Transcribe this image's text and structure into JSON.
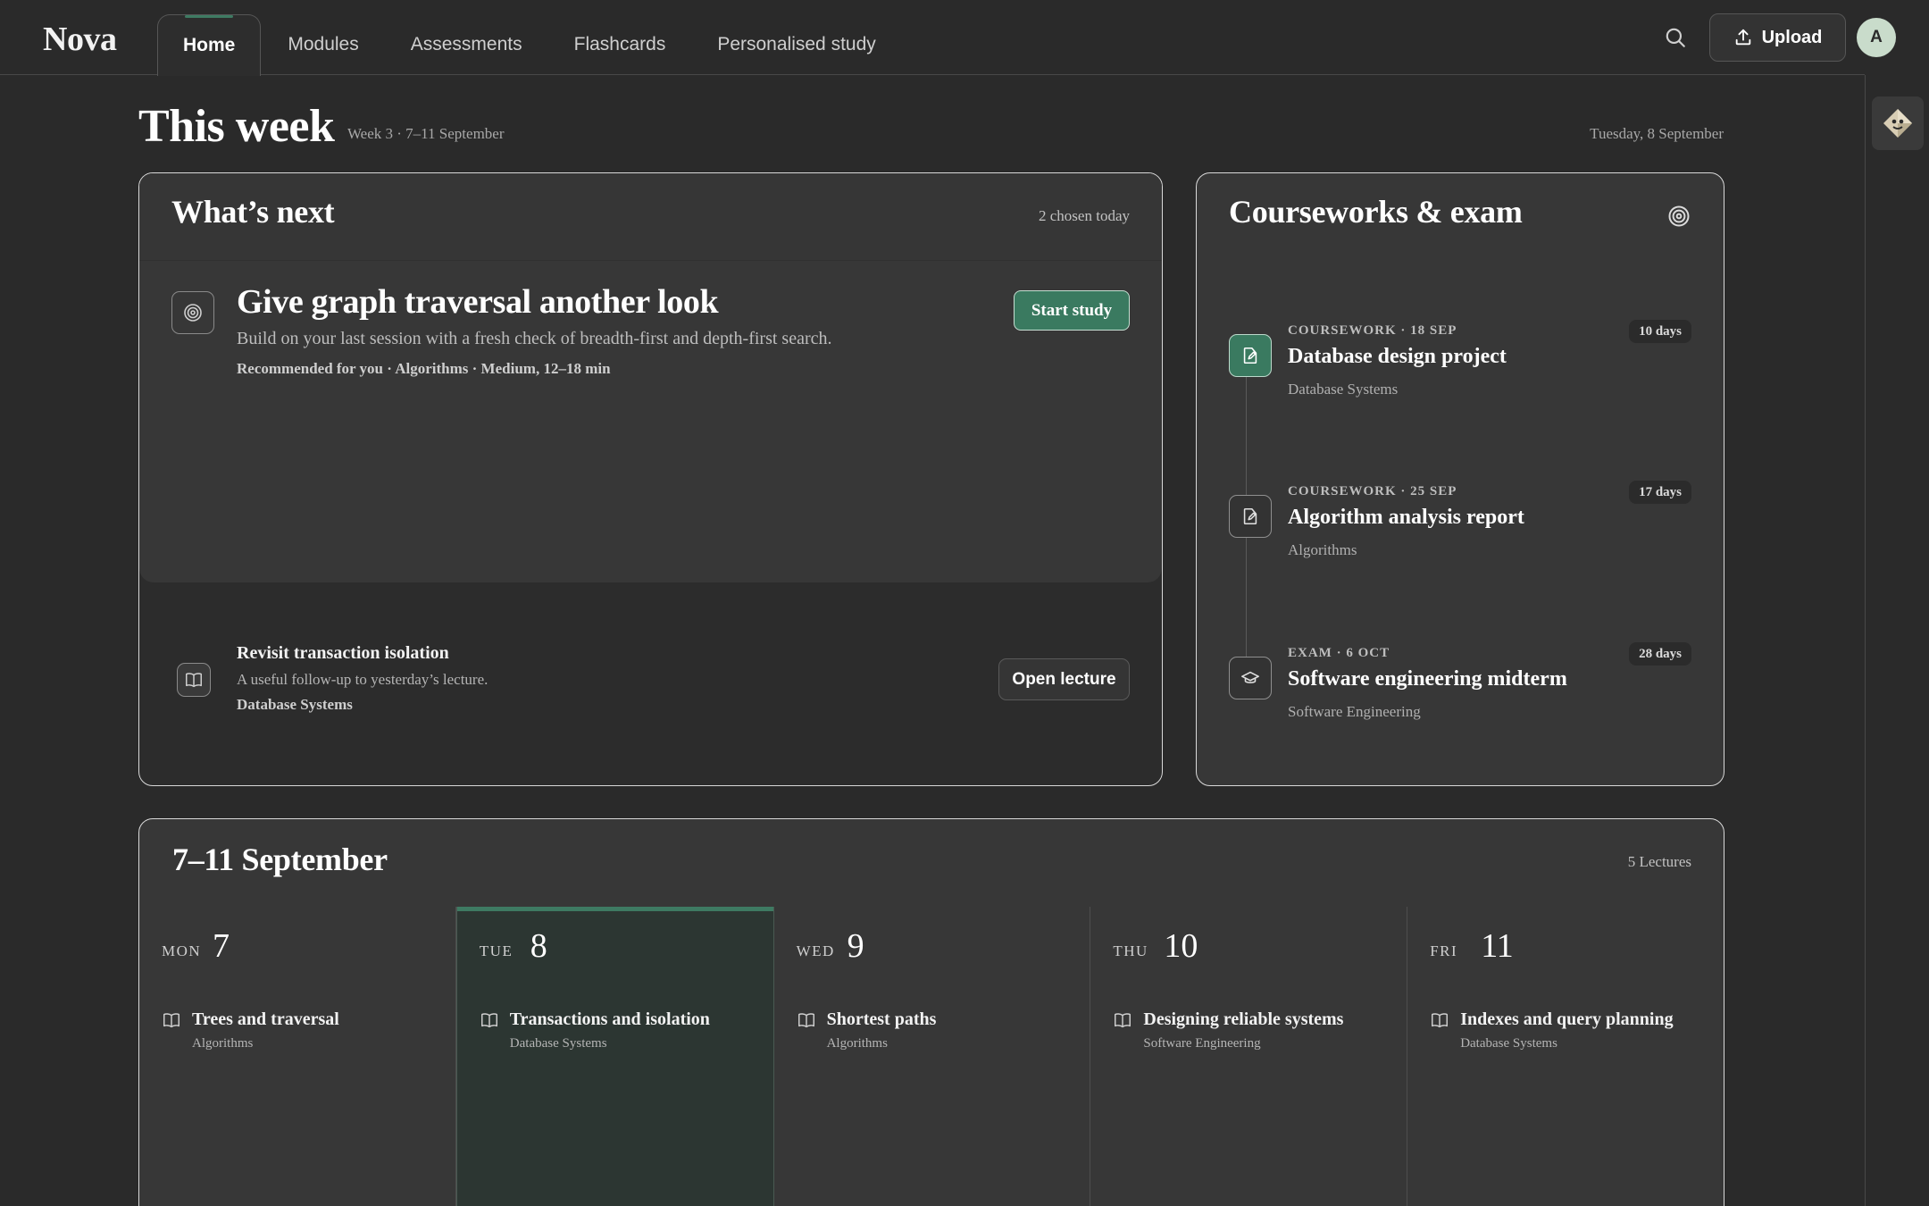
{
  "app": {
    "logo": "Nova"
  },
  "nav": {
    "tabs": [
      {
        "label": "Home",
        "active": true
      },
      {
        "label": "Modules"
      },
      {
        "label": "Assessments"
      },
      {
        "label": "Flashcards"
      },
      {
        "label": "Personalised study"
      }
    ]
  },
  "toolbar": {
    "search_icon": "search-icon",
    "upload_label": "Upload",
    "avatar_initial": "A"
  },
  "header": {
    "title": "This week",
    "subtitle": "Week 3 · 7–11 September",
    "today": "Tuesday, 8 September"
  },
  "whats_next": {
    "title": "What’s next",
    "meta": "2 chosen today",
    "primary": {
      "icon": "target-icon",
      "title": "Give graph traversal another look",
      "description": "Build on your last session with a fresh check of breadth-first and depth-first search.",
      "meta": "Recommended for you · Algorithms · Medium, 12–18 min",
      "action": "Start study"
    },
    "secondary": {
      "icon": "book-icon",
      "title": "Revisit transaction isolation",
      "description": "A useful follow-up to yesterday’s lecture.",
      "module": "Database Systems",
      "action": "Open lecture"
    }
  },
  "deadlines": {
    "title": "Courseworks & exam",
    "items": [
      {
        "kicker": "COURSEWORK · 18 SEP",
        "title": "Database design project",
        "module": "Database Systems",
        "badge": "10 days",
        "icon": "edit-document-icon"
      },
      {
        "kicker": "COURSEWORK · 25 SEP",
        "title": "Algorithm analysis report",
        "module": "Algorithms",
        "badge": "17 days",
        "icon": "edit-document-icon"
      },
      {
        "kicker": "EXAM · 6 OCT",
        "title": "Software engineering midterm",
        "module": "Software Engineering",
        "badge": "28 days",
        "icon": "graduation-cap-icon"
      }
    ]
  },
  "week": {
    "title": "7–11 September",
    "meta": "5 Lectures",
    "days": [
      {
        "name": "MON",
        "num": "7",
        "lecture": "Trees and traversal",
        "module": "Algorithms"
      },
      {
        "name": "TUE",
        "num": "8",
        "lecture": "Transactions and isolation",
        "module": "Database Systems",
        "today": true
      },
      {
        "name": "WED",
        "num": "9",
        "lecture": "Shortest paths",
        "module": "Algorithms"
      },
      {
        "name": "THU",
        "num": "10",
        "lecture": "Designing reliable systems",
        "module": "Software Engineering"
      },
      {
        "name": "FRI",
        "num": "11",
        "lecture": "Indexes and query planning",
        "module": "Database Systems"
      }
    ]
  },
  "colors": {
    "accent": "#3a7a60",
    "background": "#2a2a2a",
    "card": "#373737"
  }
}
